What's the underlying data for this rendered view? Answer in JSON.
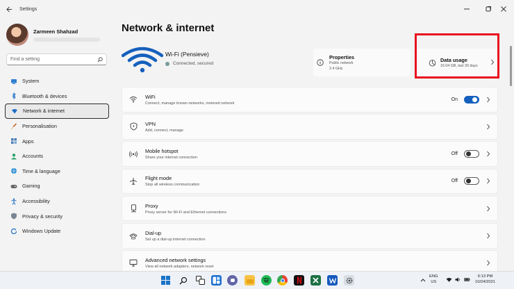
{
  "window": {
    "title": "Settings"
  },
  "profile": {
    "name": "Zarmeen Shahzad"
  },
  "search": {
    "placeholder": "Find a setting"
  },
  "sidebar": {
    "items": [
      {
        "label": "System",
        "icon": "system-icon"
      },
      {
        "label": "Bluetooth & devices",
        "icon": "bluetooth-icon"
      },
      {
        "label": "Network & internet",
        "icon": "network-icon",
        "active": true
      },
      {
        "label": "Personalisation",
        "icon": "brush-icon"
      },
      {
        "label": "Apps",
        "icon": "apps-icon"
      },
      {
        "label": "Accounts",
        "icon": "accounts-icon"
      },
      {
        "label": "Time & language",
        "icon": "globe-icon"
      },
      {
        "label": "Gaming",
        "icon": "controller-icon"
      },
      {
        "label": "Accessibility",
        "icon": "accessibility-icon"
      },
      {
        "label": "Privacy & security",
        "icon": "shield-icon"
      },
      {
        "label": "Windows Update",
        "icon": "update-icon"
      }
    ]
  },
  "main": {
    "title": "Network & internet",
    "wifi": {
      "name": "Wi-Fi (Pensieve)",
      "status": "Connected, secured"
    },
    "properties": {
      "title": "Properties",
      "line1": "Public network",
      "line2": "2.4 GHz"
    },
    "data_usage": {
      "title": "Data usage",
      "sub": "16.04 GB, last 30 days"
    },
    "rows": [
      {
        "title": "WiFi",
        "sub": "Connect, manage known networks, metered network",
        "toggle_label": "On",
        "toggle": "on",
        "icon": "wifi-icon"
      },
      {
        "title": "VPN",
        "sub": "Add, connect, manage",
        "icon": "vpn-shield-icon"
      },
      {
        "title": "Mobile hotspot",
        "sub": "Share your internet connection",
        "toggle_label": "Off",
        "toggle": "off",
        "icon": "hotspot-icon"
      },
      {
        "title": "Flight mode",
        "sub": "Stop all wireless communication",
        "toggle_label": "Off",
        "toggle": "off",
        "icon": "airplane-icon"
      },
      {
        "title": "Proxy",
        "sub": "Proxy server for Wi-Fi and Ethernet connections",
        "icon": "proxy-icon"
      },
      {
        "title": "Dial-up",
        "sub": "Set up a dial-up internet connection",
        "icon": "dialup-icon"
      },
      {
        "title": "Advanced network settings",
        "sub": "View all network adapters, network reset",
        "icon": "monitor-icon"
      }
    ]
  },
  "taskbar": {
    "lang": "ENG",
    "region": "US",
    "time": "6:13 PM",
    "date": "10/24/2021"
  },
  "colors": {
    "accent": "#1560bd",
    "highlight": "#e8111e",
    "wifi_icon": "#1560bd"
  }
}
